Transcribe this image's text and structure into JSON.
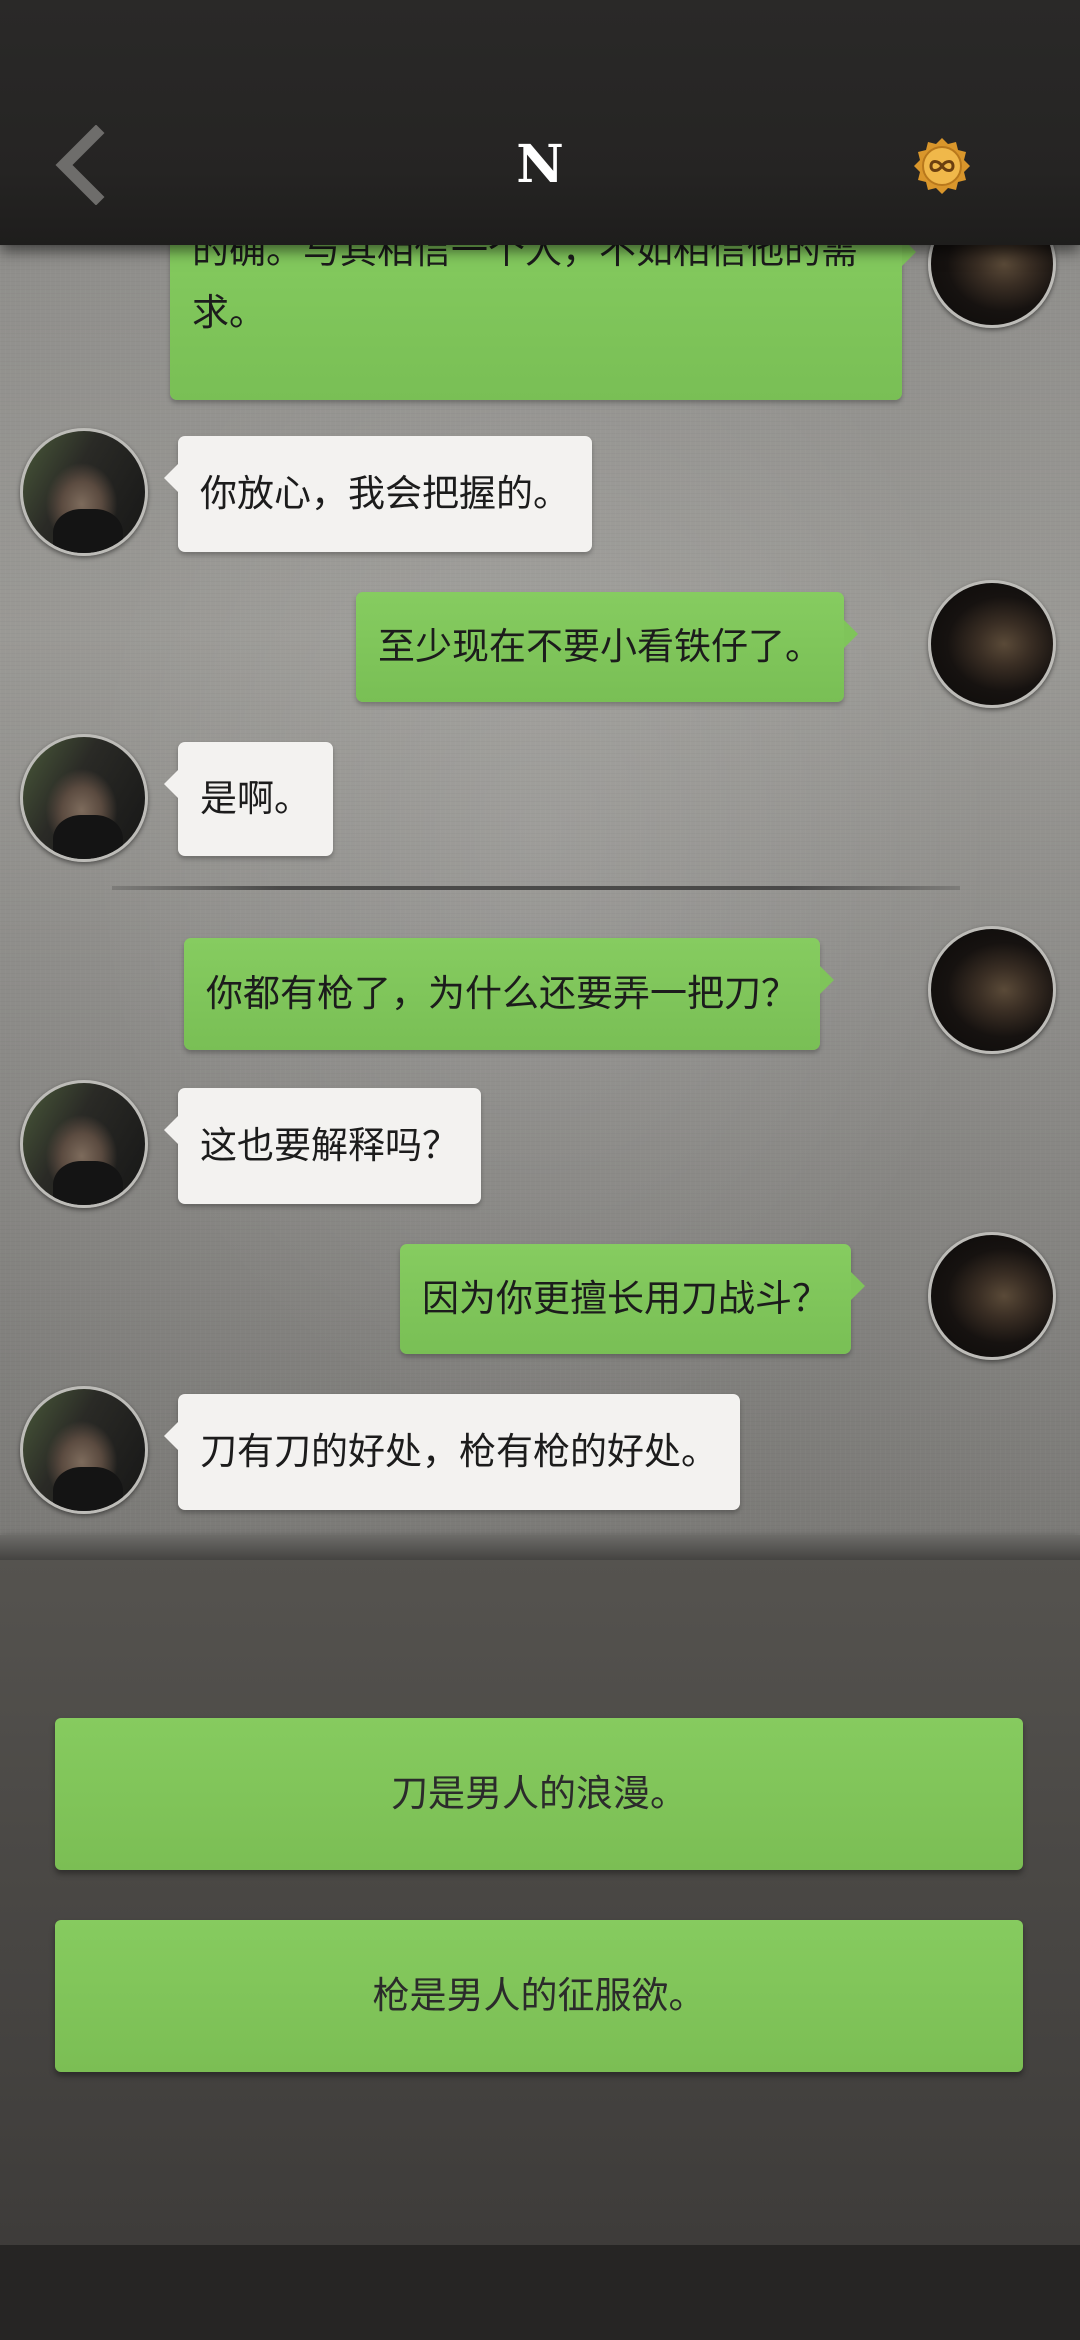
{
  "header": {
    "title": "N",
    "back_icon": "chevron-left-icon",
    "badge_icon": "infinity-coin-icon",
    "badge_color": "#e8a93a"
  },
  "messages": [
    {
      "sender": "me",
      "text": "的确。与其相信一个人，不如相信他的需求。"
    },
    {
      "sender": "them",
      "text": "你放心，我会把握的。"
    },
    {
      "sender": "me",
      "text": "至少现在不要小看铁仔了。"
    },
    {
      "sender": "them",
      "text": "是啊。"
    },
    {
      "sender": "me",
      "text": "你都有枪了，为什么还要弄一把刀？"
    },
    {
      "sender": "them",
      "text": "这也要解释吗？"
    },
    {
      "sender": "me",
      "text": "因为你更擅长用刀战斗？"
    },
    {
      "sender": "them",
      "text": "刀有刀的好处，枪有枪的好处。"
    }
  ],
  "choices": [
    {
      "label": "刀是男人的浪漫。"
    },
    {
      "label": "枪是男人的征服欲。"
    }
  ],
  "colors": {
    "my_bubble": "#7ec45a",
    "their_bubble": "#f3f2f0",
    "choice_button": "#80c458"
  }
}
